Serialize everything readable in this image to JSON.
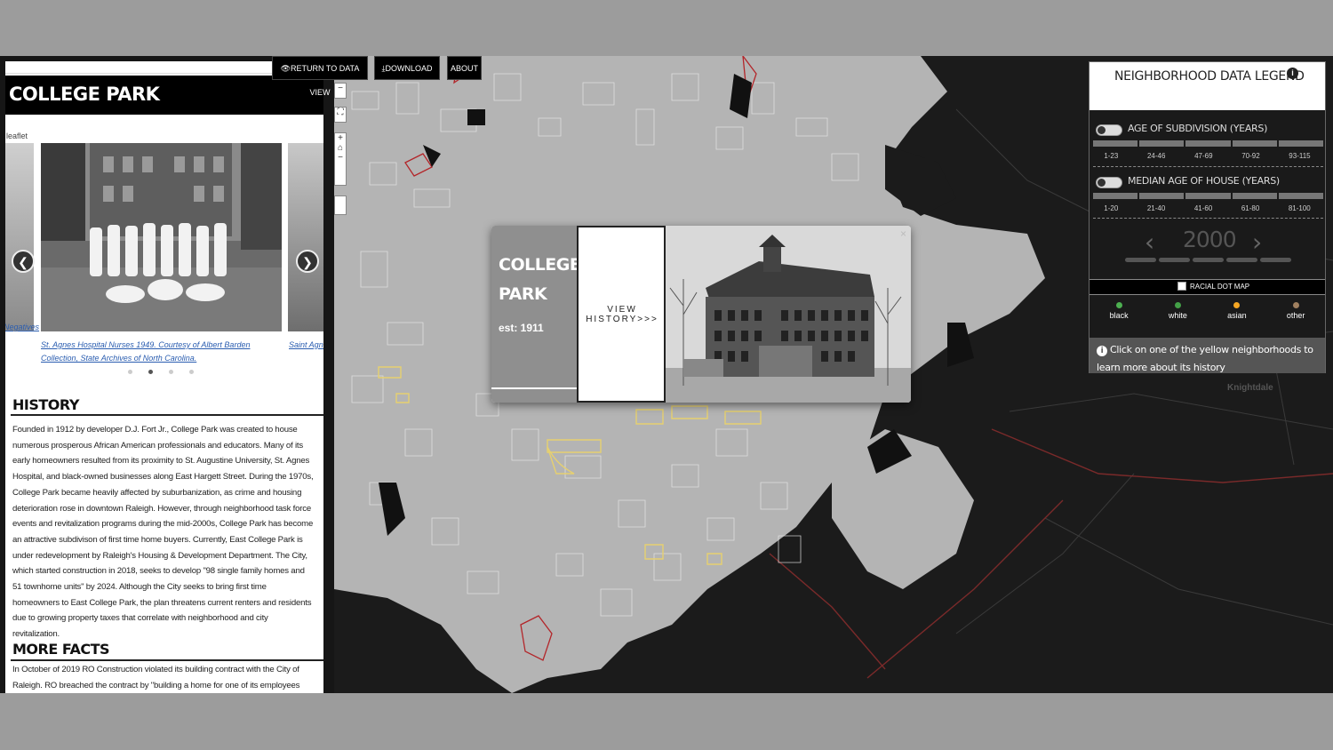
{
  "toolbar": {
    "return_label": "RETURN TO DATA VIEW",
    "download_label": "DOWNLOAD",
    "about_label": "ABOUT"
  },
  "panel": {
    "title": "COLLEGE PARK",
    "leaflet_tag": "leaflet",
    "carousel": {
      "prev_caption": "Negatives",
      "main_caption": "St. Agnes Hospital Nurses 1949. Courtesy of Albert Barden Collection, State Archives of North Carolina.",
      "next_caption": "Saint Agnes Barden Col",
      "dot_count": 4,
      "active_dot": 1
    },
    "history_heading": "HISTORY",
    "history_text": "Founded in 1912 by developer D.J. Fort Jr., College Park was created to house numerous prosperous African American professionals and educators. Many of its early homeowners resulted from its proximity to St. Augustine University, St. Agnes Hospital, and black-owned businesses along East Hargett Street. During the 1970s, College Park became heavily affected by suburbanization, as crime and housing deterioration rose in downtown Raleigh. However, through neighborhood task force events and revitalization programs during the mid-2000s, College Park has become an attractive subdivison of first time home buyers. Currently, East College Park is under redevelopment by Raleigh's Housing & Development Department. The City, which started construction in 2018, seeks to develop \"98 single family homes and 51 townhome units\" by 2024. Although the City seeks to bring first time homeowners to East College Park, the plan threatens current renters and residents due to growing property taxes that correlate with neighborhood and city revitalization.",
    "facts_heading": "MORE FACTS",
    "facts_text": "In October of 2019 RO Construction violated its building contract with the City of Raleigh. RO breached the contract by \"building a home for one of its employees larger than what is"
  },
  "popup": {
    "name": "COLLEGE PARK",
    "est": "est: 1911",
    "view_history": "VIEW HISTORY>>>",
    "close": "×"
  },
  "legend": {
    "title": "NEIGHBORHOOD DATA LEGEND",
    "info_icon": "i",
    "subdivision_label": "AGE OF SUBDIVISION (YEARS)",
    "subdivision_ticks": [
      "1-23",
      "24-46",
      "47-69",
      "70-92",
      "93-115"
    ],
    "house_label": "MEDIAN AGE OF HOUSE (YEARS)",
    "house_ticks": [
      "1-20",
      "21-40",
      "41-60",
      "61-80",
      "81-100"
    ],
    "year": "2000",
    "racial_label": "RACIAL DOT MAP",
    "races": [
      {
        "label": "black",
        "color": "#4caf50"
      },
      {
        "label": "white",
        "color": "#43a047"
      },
      {
        "label": "asian",
        "color": "#f5a623"
      },
      {
        "label": "other",
        "color": "#a08060"
      }
    ],
    "note": "Click on one of the yellow neighborhoods to learn more about its history"
  },
  "map": {
    "place_labels": [
      "Knightdale"
    ]
  }
}
